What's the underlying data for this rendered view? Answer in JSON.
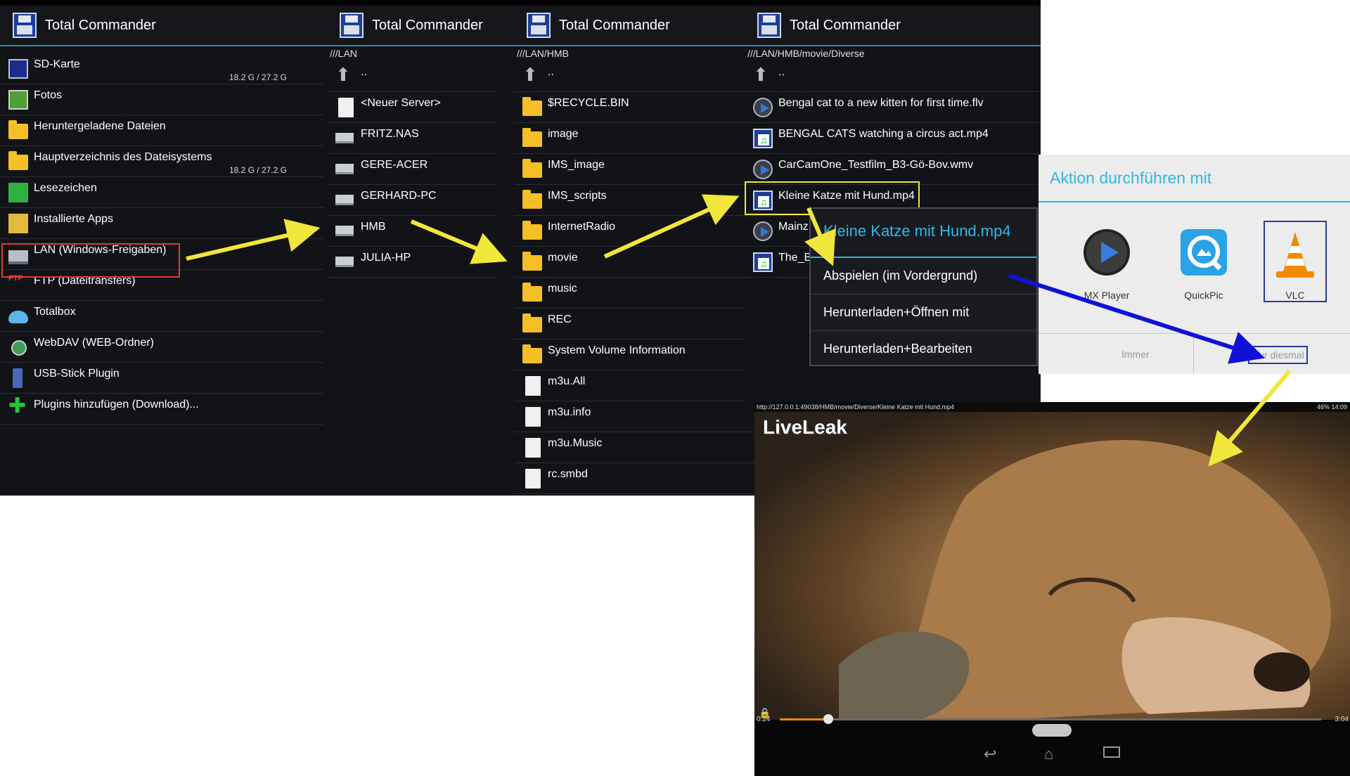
{
  "panels": [
    {
      "title": "Total Commander",
      "path": "",
      "items": [
        {
          "name": "SD-Karte",
          "size": "18.2 G / 27.2 G"
        },
        {
          "name": "Fotos",
          "size": ""
        },
        {
          "name": "Heruntergeladene Dateien",
          "size": ""
        },
        {
          "name": "Hauptverzeichnis des Dateisystems",
          "size": "18.2 G / 27.2 G"
        },
        {
          "name": "Lesezeichen",
          "size": ""
        },
        {
          "name": "Installierte Apps",
          "size": ""
        },
        {
          "name": "LAN (Windows-Freigaben)",
          "size": ""
        },
        {
          "name": "FTP (Dateitransfers)",
          "size": ""
        },
        {
          "name": "Totalbox",
          "size": ""
        },
        {
          "name": "WebDAV (WEB-Ordner)",
          "size": ""
        },
        {
          "name": "USB-Stick Plugin",
          "size": ""
        },
        {
          "name": "Plugins hinzufügen (Download)...",
          "size": ""
        }
      ]
    },
    {
      "title": "Total Commander",
      "path": "///LAN",
      "items": [
        {
          "name": ".."
        },
        {
          "name": "<Neuer Server>"
        },
        {
          "name": "FRITZ.NAS"
        },
        {
          "name": "GERE-ACER"
        },
        {
          "name": "GERHARD-PC"
        },
        {
          "name": "HMB"
        },
        {
          "name": "JULIA-HP"
        }
      ]
    },
    {
      "title": "Total Commander",
      "path": "///LAN/HMB",
      "items": [
        {
          "name": ".."
        },
        {
          "name": "$RECYCLE.BIN"
        },
        {
          "name": "image"
        },
        {
          "name": "IMS_image"
        },
        {
          "name": "IMS_scripts"
        },
        {
          "name": "InternetRadio"
        },
        {
          "name": "movie"
        },
        {
          "name": "music"
        },
        {
          "name": "REC"
        },
        {
          "name": "System Volume Information"
        },
        {
          "name": "m3u.All"
        },
        {
          "name": "m3u.info"
        },
        {
          "name": "m3u.Music"
        },
        {
          "name": "rc.smbd"
        }
      ]
    },
    {
      "title": "Total Commander",
      "path": "///LAN/HMB/movie/Diverse",
      "items": [
        {
          "name": ".."
        },
        {
          "name": "Bengal cat to a new kitten for first time.flv"
        },
        {
          "name": "BENGAL CATS watching a circus act.mp4"
        },
        {
          "name": "CarCamOne_Testfilm_B3-Gö-Bov.wmv"
        },
        {
          "name": "Kleine Katze mit Hund.mp4"
        },
        {
          "name": "Mainz"
        },
        {
          "name": "The_Be"
        }
      ]
    }
  ],
  "context_menu": {
    "title": "Kleine Katze mit Hund.mp4",
    "items": [
      "Abspielen (im Vordergrund)",
      "Herunterladen+Öffnen mit",
      "Herunterladen+Bearbeiten"
    ]
  },
  "chooser": {
    "title": "Aktion durchführen mit",
    "apps": [
      "MX Player",
      "QuickPic",
      "VLC"
    ],
    "always": "Immer",
    "once": "Nur diesmal"
  },
  "video": {
    "url": "http://127.0.0.1:49038/HMB/movie/Diverse/Kleine Katze mit Hund.mp4",
    "status": "46% 14:09",
    "watermark": "LiveLeak",
    "elapsed": "0:24",
    "duration": "3:04",
    "progress": 0.09
  },
  "colors": {
    "accent": "#33b5e5",
    "arrow_yellow": "#f1e63a",
    "arrow_blue": "#1010d8",
    "highlight_red": "#e03b3b"
  }
}
